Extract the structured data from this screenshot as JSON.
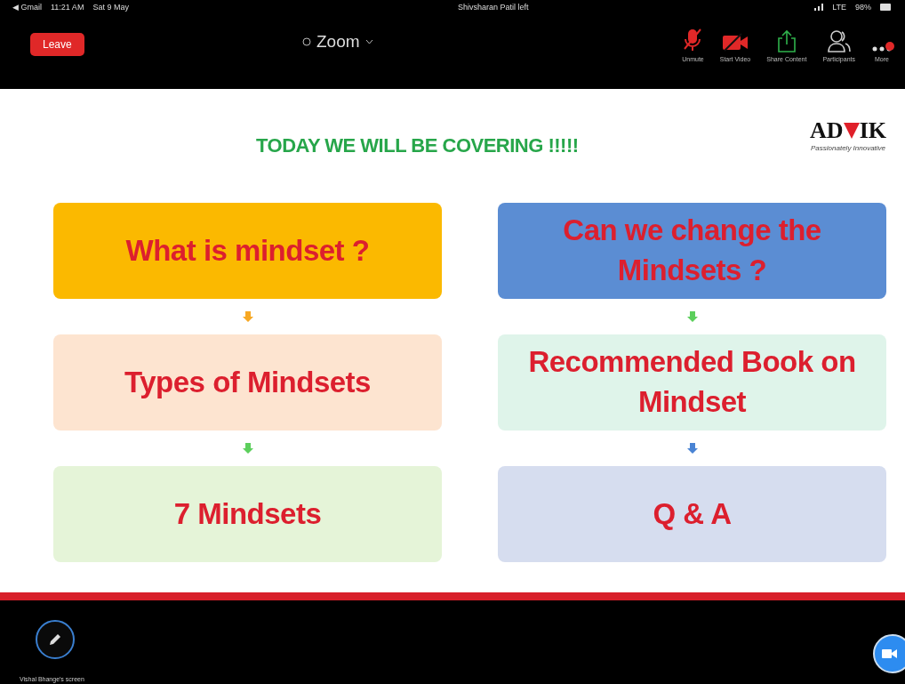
{
  "status_bar": {
    "back_app": "◀ Gmail",
    "time": "11:21 AM",
    "date": "Sat 9 May",
    "notice": "Shivsharan Patil left",
    "network": "LTE",
    "battery": "98%"
  },
  "toolbar": {
    "leave": "Leave",
    "title": "Zoom",
    "actions": [
      {
        "kind": "mic",
        "label": "Unmute"
      },
      {
        "kind": "video",
        "label": "Start Video"
      },
      {
        "kind": "share",
        "label": "Share Content"
      },
      {
        "kind": "participants",
        "label": "Participants"
      },
      {
        "kind": "more",
        "label": "More"
      }
    ]
  },
  "slide": {
    "heading": "TODAY WE WILL BE COVERING !!!!!",
    "logo": {
      "left": "AD",
      "right": "IK",
      "tagline": "Passionately Innovative"
    },
    "columns": [
      {
        "cards": [
          {
            "text": "What is mindset ?",
            "color": "#fbb900"
          },
          {
            "text": "Types of Mindsets",
            "color": "#fde4d0"
          },
          {
            "text": "7 Mindsets",
            "color": "#e5f4d8"
          }
        ],
        "arrows": [
          {
            "color": "#f7a823"
          },
          {
            "color": "#5ccf5c"
          }
        ]
      },
      {
        "cards": [
          {
            "text": "Can we change the Mindsets ?",
            "color": "#5b8dd3"
          },
          {
            "text": "Recommended Book on Mindset",
            "color": "#dff4ea"
          },
          {
            "text": "Q & A",
            "color": "#d6ddef"
          }
        ],
        "arrows": [
          {
            "color": "#5ccf5c"
          },
          {
            "color": "#4a84d4"
          }
        ]
      }
    ]
  },
  "footer": {
    "screen_owner": "Vishal Bhange's screen"
  }
}
